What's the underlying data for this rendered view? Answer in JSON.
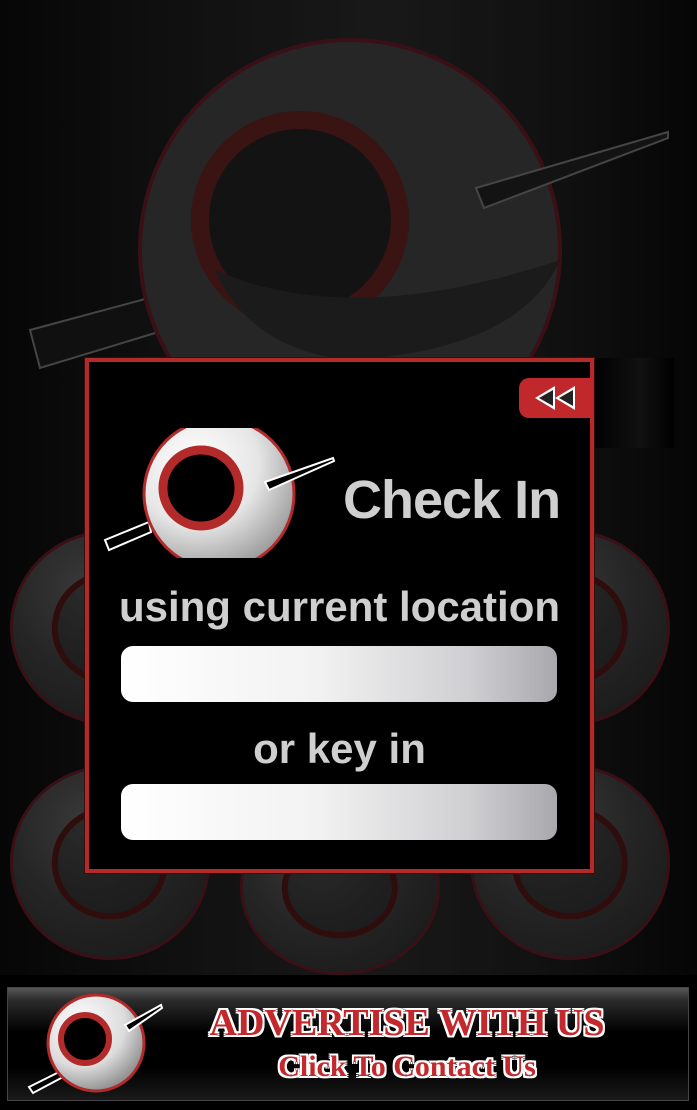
{
  "checkin": {
    "title": "Check In",
    "subtitle": "using current location",
    "location_value": "",
    "or_label": "or key in",
    "key_in_value": ""
  },
  "icons": {
    "back": "rewind-icon",
    "logo": "eye-logo-icon"
  },
  "ad_banner": {
    "line1": "ADVERTISE WITH US",
    "line2": "Click To Contact Us"
  },
  "colors": {
    "accent": "#c0282b",
    "text": "#cfcfcf",
    "background": "#000000"
  }
}
